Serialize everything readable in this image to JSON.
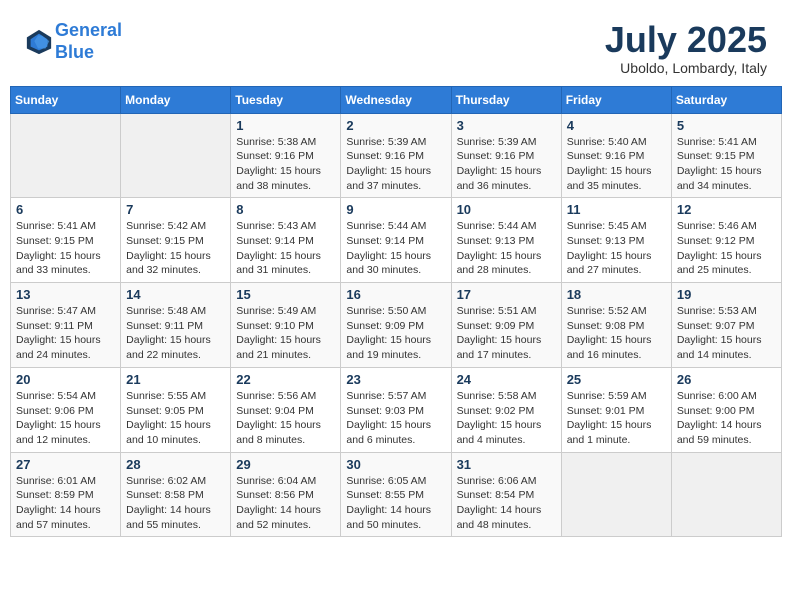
{
  "header": {
    "logo_line1": "General",
    "logo_line2": "Blue",
    "month_title": "July 2025",
    "location": "Uboldo, Lombardy, Italy"
  },
  "weekdays": [
    "Sunday",
    "Monday",
    "Tuesday",
    "Wednesday",
    "Thursday",
    "Friday",
    "Saturday"
  ],
  "weeks": [
    [
      {
        "day": "",
        "sunrise": "",
        "sunset": "",
        "daylight": ""
      },
      {
        "day": "",
        "sunrise": "",
        "sunset": "",
        "daylight": ""
      },
      {
        "day": "1",
        "sunrise": "Sunrise: 5:38 AM",
        "sunset": "Sunset: 9:16 PM",
        "daylight": "Daylight: 15 hours and 38 minutes."
      },
      {
        "day": "2",
        "sunrise": "Sunrise: 5:39 AM",
        "sunset": "Sunset: 9:16 PM",
        "daylight": "Daylight: 15 hours and 37 minutes."
      },
      {
        "day": "3",
        "sunrise": "Sunrise: 5:39 AM",
        "sunset": "Sunset: 9:16 PM",
        "daylight": "Daylight: 15 hours and 36 minutes."
      },
      {
        "day": "4",
        "sunrise": "Sunrise: 5:40 AM",
        "sunset": "Sunset: 9:16 PM",
        "daylight": "Daylight: 15 hours and 35 minutes."
      },
      {
        "day": "5",
        "sunrise": "Sunrise: 5:41 AM",
        "sunset": "Sunset: 9:15 PM",
        "daylight": "Daylight: 15 hours and 34 minutes."
      }
    ],
    [
      {
        "day": "6",
        "sunrise": "Sunrise: 5:41 AM",
        "sunset": "Sunset: 9:15 PM",
        "daylight": "Daylight: 15 hours and 33 minutes."
      },
      {
        "day": "7",
        "sunrise": "Sunrise: 5:42 AM",
        "sunset": "Sunset: 9:15 PM",
        "daylight": "Daylight: 15 hours and 32 minutes."
      },
      {
        "day": "8",
        "sunrise": "Sunrise: 5:43 AM",
        "sunset": "Sunset: 9:14 PM",
        "daylight": "Daylight: 15 hours and 31 minutes."
      },
      {
        "day": "9",
        "sunrise": "Sunrise: 5:44 AM",
        "sunset": "Sunset: 9:14 PM",
        "daylight": "Daylight: 15 hours and 30 minutes."
      },
      {
        "day": "10",
        "sunrise": "Sunrise: 5:44 AM",
        "sunset": "Sunset: 9:13 PM",
        "daylight": "Daylight: 15 hours and 28 minutes."
      },
      {
        "day": "11",
        "sunrise": "Sunrise: 5:45 AM",
        "sunset": "Sunset: 9:13 PM",
        "daylight": "Daylight: 15 hours and 27 minutes."
      },
      {
        "day": "12",
        "sunrise": "Sunrise: 5:46 AM",
        "sunset": "Sunset: 9:12 PM",
        "daylight": "Daylight: 15 hours and 25 minutes."
      }
    ],
    [
      {
        "day": "13",
        "sunrise": "Sunrise: 5:47 AM",
        "sunset": "Sunset: 9:11 PM",
        "daylight": "Daylight: 15 hours and 24 minutes."
      },
      {
        "day": "14",
        "sunrise": "Sunrise: 5:48 AM",
        "sunset": "Sunset: 9:11 PM",
        "daylight": "Daylight: 15 hours and 22 minutes."
      },
      {
        "day": "15",
        "sunrise": "Sunrise: 5:49 AM",
        "sunset": "Sunset: 9:10 PM",
        "daylight": "Daylight: 15 hours and 21 minutes."
      },
      {
        "day": "16",
        "sunrise": "Sunrise: 5:50 AM",
        "sunset": "Sunset: 9:09 PM",
        "daylight": "Daylight: 15 hours and 19 minutes."
      },
      {
        "day": "17",
        "sunrise": "Sunrise: 5:51 AM",
        "sunset": "Sunset: 9:09 PM",
        "daylight": "Daylight: 15 hours and 17 minutes."
      },
      {
        "day": "18",
        "sunrise": "Sunrise: 5:52 AM",
        "sunset": "Sunset: 9:08 PM",
        "daylight": "Daylight: 15 hours and 16 minutes."
      },
      {
        "day": "19",
        "sunrise": "Sunrise: 5:53 AM",
        "sunset": "Sunset: 9:07 PM",
        "daylight": "Daylight: 15 hours and 14 minutes."
      }
    ],
    [
      {
        "day": "20",
        "sunrise": "Sunrise: 5:54 AM",
        "sunset": "Sunset: 9:06 PM",
        "daylight": "Daylight: 15 hours and 12 minutes."
      },
      {
        "day": "21",
        "sunrise": "Sunrise: 5:55 AM",
        "sunset": "Sunset: 9:05 PM",
        "daylight": "Daylight: 15 hours and 10 minutes."
      },
      {
        "day": "22",
        "sunrise": "Sunrise: 5:56 AM",
        "sunset": "Sunset: 9:04 PM",
        "daylight": "Daylight: 15 hours and 8 minutes."
      },
      {
        "day": "23",
        "sunrise": "Sunrise: 5:57 AM",
        "sunset": "Sunset: 9:03 PM",
        "daylight": "Daylight: 15 hours and 6 minutes."
      },
      {
        "day": "24",
        "sunrise": "Sunrise: 5:58 AM",
        "sunset": "Sunset: 9:02 PM",
        "daylight": "Daylight: 15 hours and 4 minutes."
      },
      {
        "day": "25",
        "sunrise": "Sunrise: 5:59 AM",
        "sunset": "Sunset: 9:01 PM",
        "daylight": "Daylight: 15 hours and 1 minute."
      },
      {
        "day": "26",
        "sunrise": "Sunrise: 6:00 AM",
        "sunset": "Sunset: 9:00 PM",
        "daylight": "Daylight: 14 hours and 59 minutes."
      }
    ],
    [
      {
        "day": "27",
        "sunrise": "Sunrise: 6:01 AM",
        "sunset": "Sunset: 8:59 PM",
        "daylight": "Daylight: 14 hours and 57 minutes."
      },
      {
        "day": "28",
        "sunrise": "Sunrise: 6:02 AM",
        "sunset": "Sunset: 8:58 PM",
        "daylight": "Daylight: 14 hours and 55 minutes."
      },
      {
        "day": "29",
        "sunrise": "Sunrise: 6:04 AM",
        "sunset": "Sunset: 8:56 PM",
        "daylight": "Daylight: 14 hours and 52 minutes."
      },
      {
        "day": "30",
        "sunrise": "Sunrise: 6:05 AM",
        "sunset": "Sunset: 8:55 PM",
        "daylight": "Daylight: 14 hours and 50 minutes."
      },
      {
        "day": "31",
        "sunrise": "Sunrise: 6:06 AM",
        "sunset": "Sunset: 8:54 PM",
        "daylight": "Daylight: 14 hours and 48 minutes."
      },
      {
        "day": "",
        "sunrise": "",
        "sunset": "",
        "daylight": ""
      },
      {
        "day": "",
        "sunrise": "",
        "sunset": "",
        "daylight": ""
      }
    ]
  ]
}
